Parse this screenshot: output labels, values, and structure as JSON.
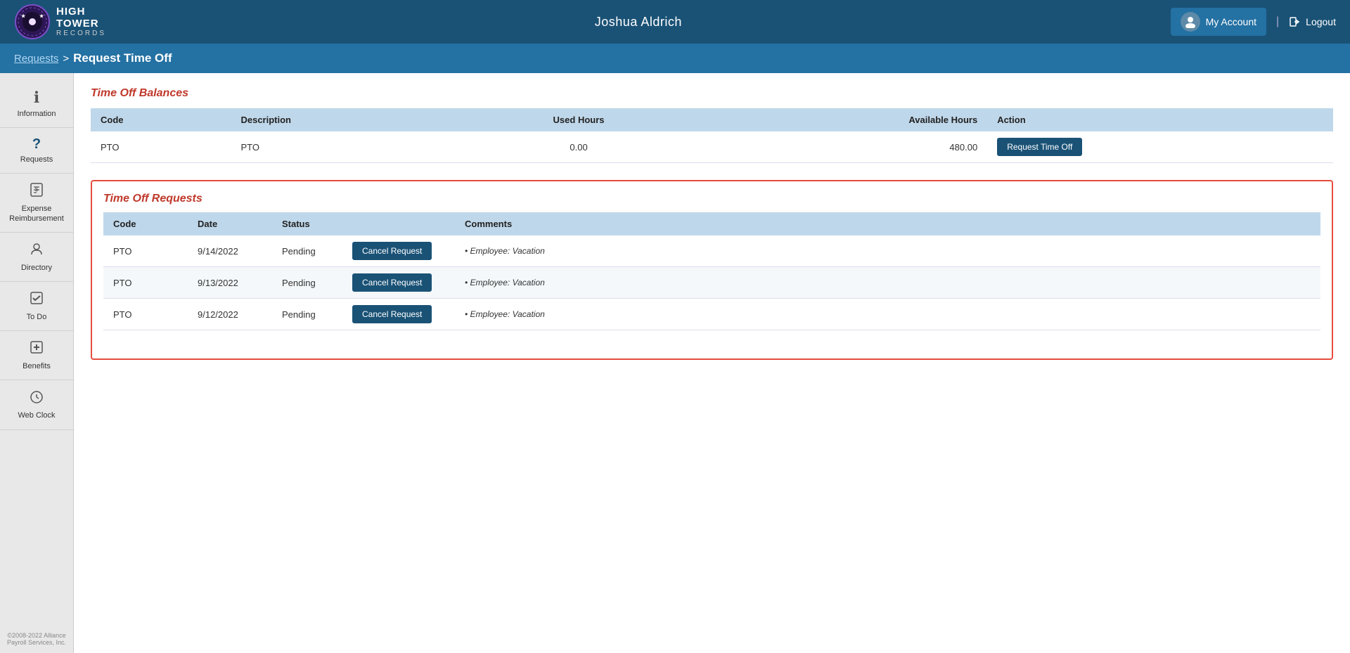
{
  "header": {
    "logo_line1": "HIGH",
    "logo_line2": "TOWER",
    "logo_line3": "RECORDS",
    "user_name": "Joshua Aldrich",
    "my_account_label": "My Account",
    "logout_label": "Logout"
  },
  "breadcrumb": {
    "parent_label": "Requests",
    "separator": ">",
    "current_label": "Request Time Off"
  },
  "sidebar": {
    "items": [
      {
        "id": "information",
        "label": "Information",
        "icon": "ℹ"
      },
      {
        "id": "requests",
        "label": "Requests",
        "icon": "?"
      },
      {
        "id": "expense",
        "label": "Expense Reimbursement",
        "icon": "💲"
      },
      {
        "id": "directory",
        "label": "Directory",
        "icon": "👤"
      },
      {
        "id": "todo",
        "label": "To Do",
        "icon": "☑"
      },
      {
        "id": "benefits",
        "label": "Benefits",
        "icon": "➕"
      },
      {
        "id": "webclock",
        "label": "Web Clock",
        "icon": "🕐"
      }
    ],
    "footer": "©2008-2022 Alliance Payroll Services, Inc."
  },
  "time_off_balances": {
    "title": "Time Off Balances",
    "columns": [
      "Code",
      "Description",
      "Used Hours",
      "Available Hours",
      "Action"
    ],
    "rows": [
      {
        "code": "PTO",
        "description": "PTO",
        "used_hours": "0.00",
        "available_hours": "480.00",
        "action_label": "Request Time Off"
      }
    ]
  },
  "time_off_requests": {
    "title": "Time Off Requests",
    "columns": [
      "Code",
      "Date",
      "Status",
      "",
      "Comments"
    ],
    "rows": [
      {
        "code": "PTO",
        "date": "9/14/2022",
        "status": "Pending",
        "cancel_label": "Cancel Request",
        "comment": "• Employee: Vacation"
      },
      {
        "code": "PTO",
        "date": "9/13/2022",
        "status": "Pending",
        "cancel_label": "Cancel Request",
        "comment": "• Employee: Vacation"
      },
      {
        "code": "PTO",
        "date": "9/12/2022",
        "status": "Pending",
        "cancel_label": "Cancel Request",
        "comment": "• Employee: Vacation"
      }
    ]
  }
}
